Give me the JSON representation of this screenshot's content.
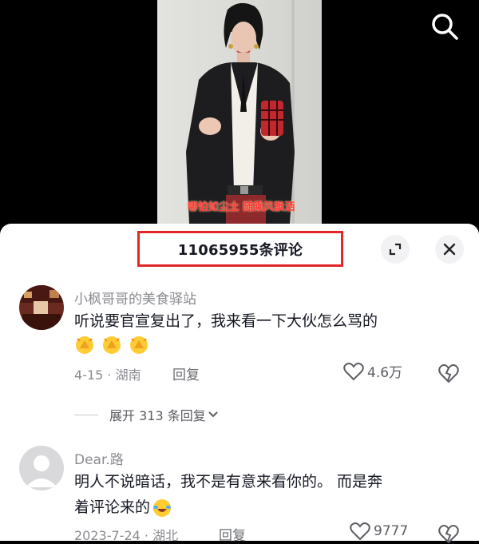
{
  "video": {
    "caption": "哪怕如尘土 随乘风飘洒",
    "search_icon": "search-icon"
  },
  "comments_panel": {
    "title": "11065955条评论",
    "expand_icon": "expand-icon",
    "close_icon": "close-icon",
    "highlight_color": "#e3262a",
    "comments": [
      {
        "username": "小枫哥哥的美食驿站",
        "text": "听说要官宣复出了，我来看一下大伙怎么骂的",
        "emojis": [
          "clap-emoji",
          "clap-emoji",
          "clap-emoji"
        ],
        "date_location": "4-15 · 湖南",
        "reply_label": "回复",
        "likes": "4.6万",
        "expand_replies": "展开 313 条回复"
      },
      {
        "username": "Dear.路",
        "text_line1": "明人不说暗话，我不是有意来看你的。 而是奔",
        "text_line2": "着评论来的",
        "emoji": "laughing-tears-emoji",
        "date_location": "2023-7-24 · 湖北",
        "reply_label": "回复",
        "likes": "9777"
      }
    ]
  }
}
